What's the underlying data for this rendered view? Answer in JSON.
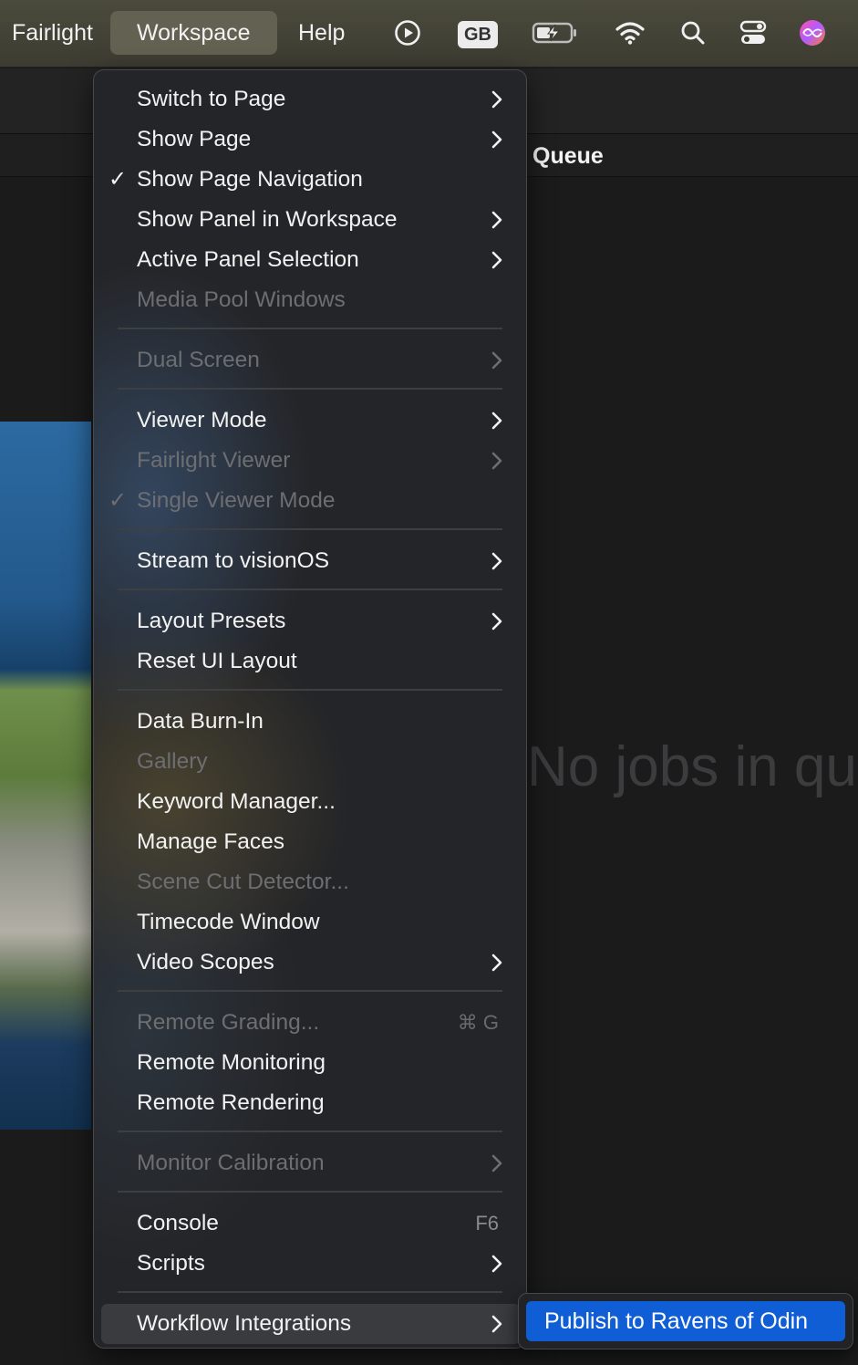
{
  "menubar": {
    "app_name": "Fairlight",
    "menus": [
      "Workspace",
      "Help"
    ],
    "active_menu": "Workspace",
    "status": {
      "keyboard_layout": "GB"
    }
  },
  "app": {
    "queue_title": "Queue",
    "queue_empty_text": "No jobs in queue"
  },
  "menu": {
    "items": [
      {
        "label": "Switch to Page",
        "enabled": true,
        "submenu": true
      },
      {
        "label": "Show Page",
        "enabled": true,
        "submenu": true
      },
      {
        "label": "Show Page Navigation",
        "enabled": true,
        "checked": true
      },
      {
        "label": "Show Panel in Workspace",
        "enabled": true,
        "submenu": true
      },
      {
        "label": "Active Panel Selection",
        "enabled": true,
        "submenu": true
      },
      {
        "label": "Media Pool Windows",
        "enabled": false
      },
      {
        "label": "Dual Screen",
        "enabled": false,
        "submenu": true
      },
      {
        "label": "Viewer Mode",
        "enabled": true,
        "submenu": true
      },
      {
        "label": "Fairlight Viewer",
        "enabled": false,
        "submenu": true
      },
      {
        "label": "Single Viewer Mode",
        "enabled": false,
        "checked": true
      },
      {
        "label": "Stream to visionOS",
        "enabled": true,
        "submenu": true
      },
      {
        "label": "Layout Presets",
        "enabled": true,
        "submenu": true
      },
      {
        "label": "Reset UI Layout",
        "enabled": true
      },
      {
        "label": "Data Burn-In",
        "enabled": true
      },
      {
        "label": "Gallery",
        "enabled": false
      },
      {
        "label": "Keyword Manager...",
        "enabled": true
      },
      {
        "label": "Manage Faces",
        "enabled": true
      },
      {
        "label": "Scene Cut Detector...",
        "enabled": false
      },
      {
        "label": "Timecode Window",
        "enabled": true
      },
      {
        "label": "Video Scopes",
        "enabled": true,
        "submenu": true
      },
      {
        "label": "Remote Grading...",
        "enabled": false,
        "shortcut": "⌘ G"
      },
      {
        "label": "Remote Monitoring",
        "enabled": true
      },
      {
        "label": "Remote Rendering",
        "enabled": true
      },
      {
        "label": "Monitor Calibration",
        "enabled": false,
        "submenu": true
      },
      {
        "label": "Console",
        "enabled": true,
        "shortcut": "F6"
      },
      {
        "label": "Scripts",
        "enabled": true,
        "submenu": true
      },
      {
        "label": "Workflow Integrations",
        "enabled": true,
        "submenu": true,
        "highlighted": true
      }
    ]
  },
  "submenu": {
    "items": [
      {
        "label": "Publish to Ravens of Odin",
        "selected": true
      }
    ]
  },
  "colors": {
    "menubar_bg": "#3d3c32",
    "menu_bg": "#242528",
    "disabled_text": "#6d6e72",
    "selection_blue": "#0f5ed6"
  }
}
